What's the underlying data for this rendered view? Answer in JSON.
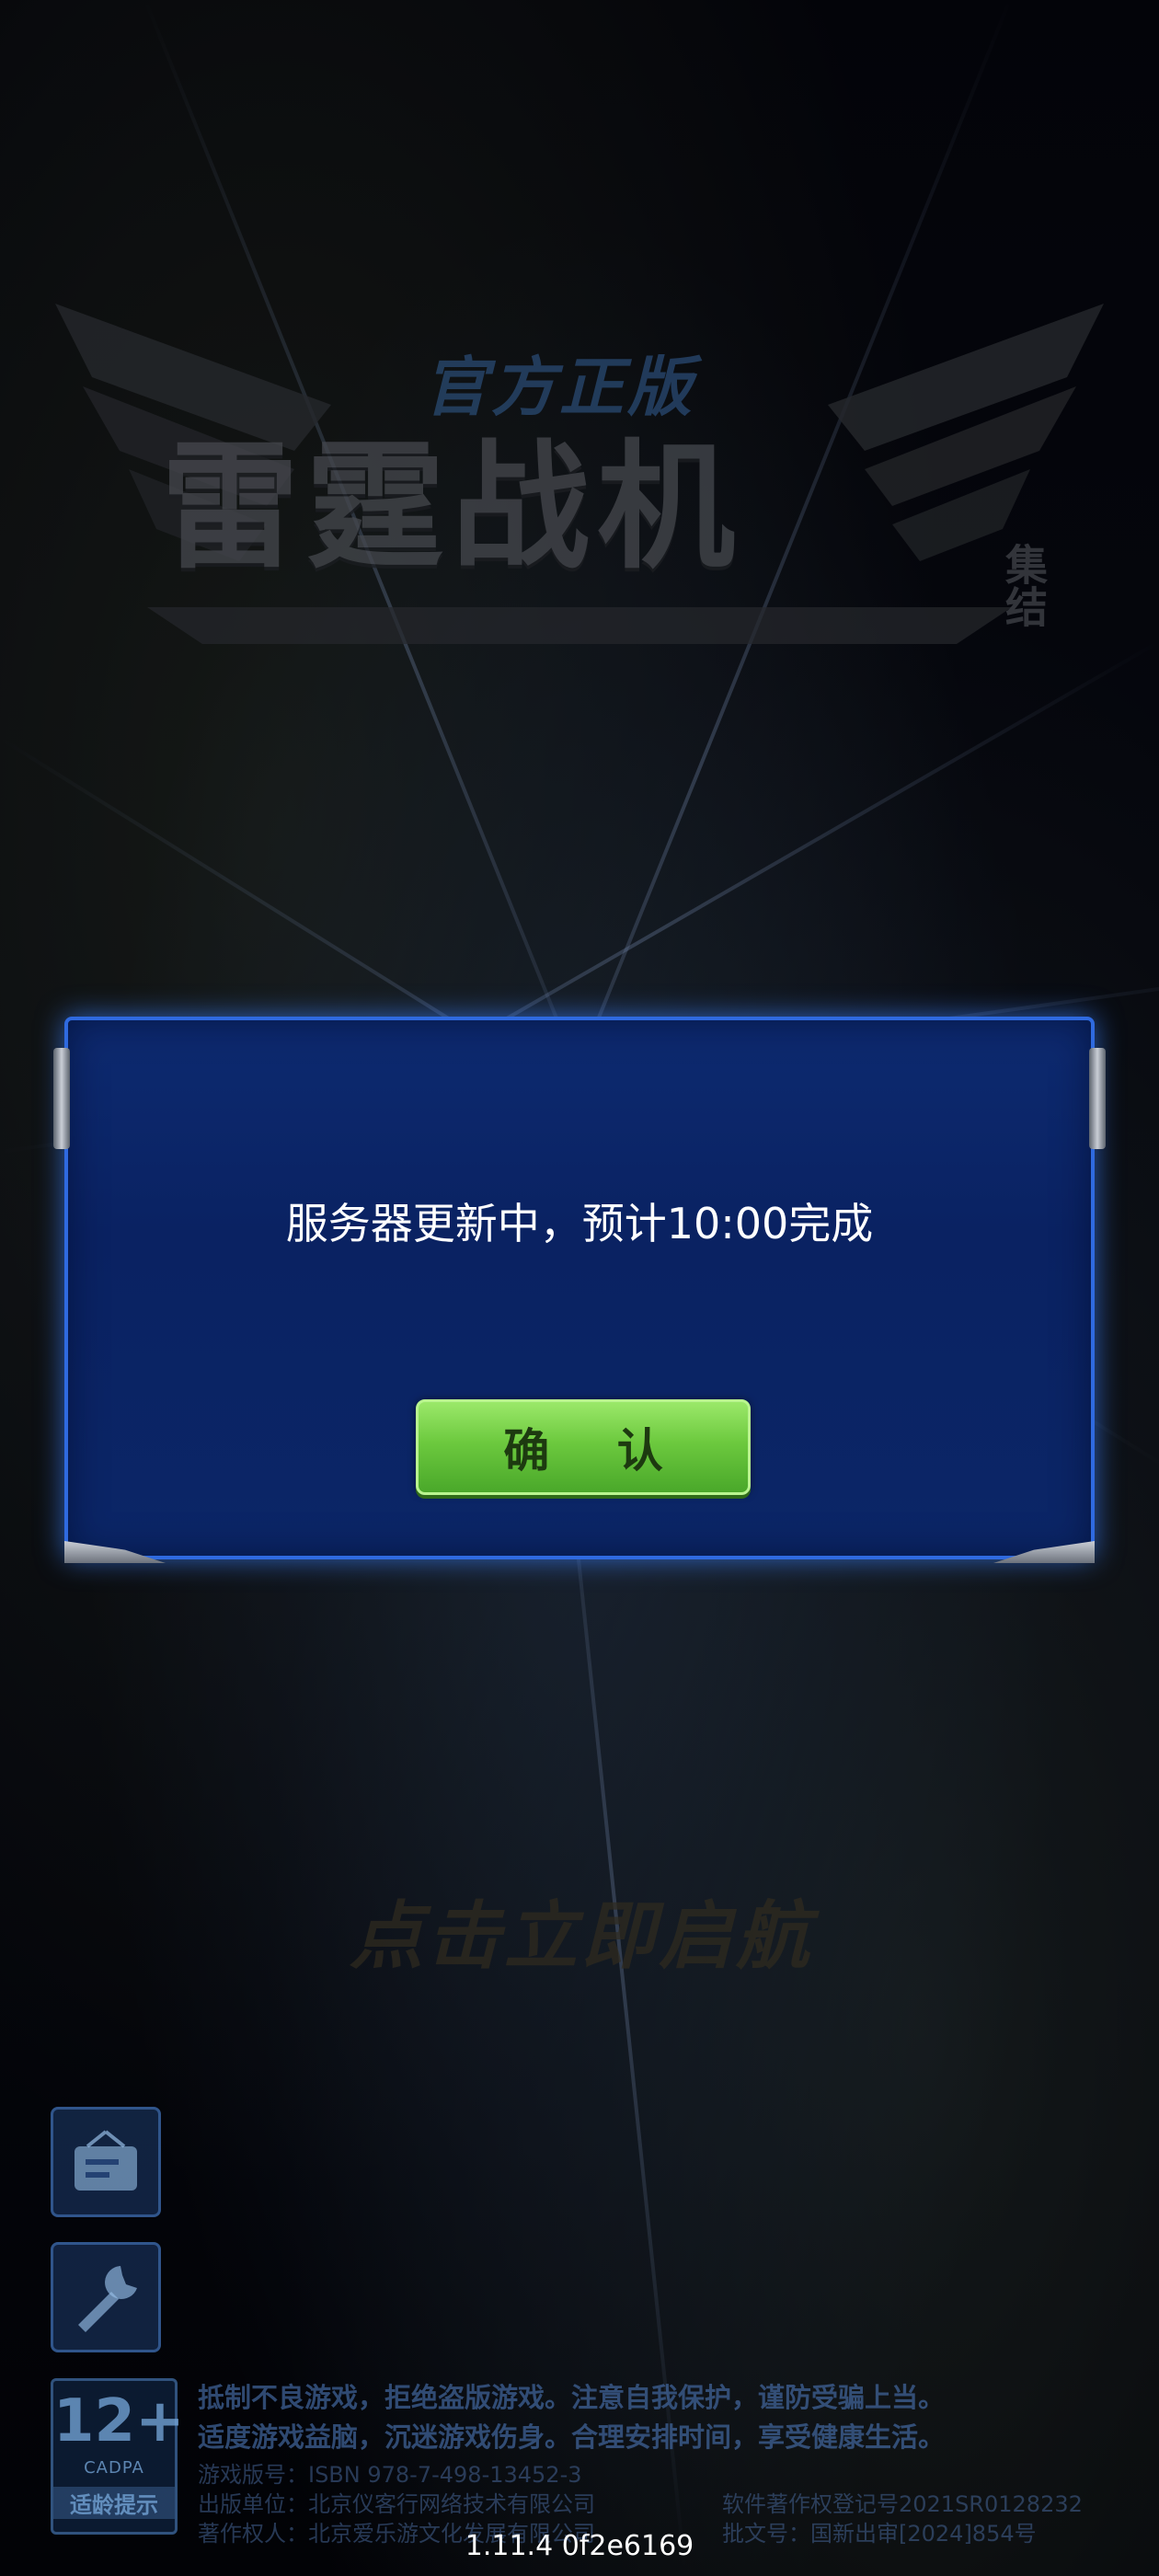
{
  "logo": {
    "subtitle": "官方正版",
    "title": "雷霆战机",
    "tag": "集结"
  },
  "start_prompt": "点击立即启航",
  "dialog": {
    "message": "服务器更新中，预计10:00完成",
    "confirm_label": "确 认"
  },
  "side_buttons": [
    {
      "icon": "notice-board-icon"
    },
    {
      "icon": "wrench-icon"
    }
  ],
  "age_rating": {
    "number": "12+",
    "org": "CADPA",
    "tip": "适龄提示"
  },
  "footer": {
    "notice_line1": "抵制不良游戏，拒绝盗版游戏。注意自我保护，谨防受骗上当。",
    "notice_line2": "适度游戏益脑，沉迷游戏伤身。合理安排时间，享受健康生活。",
    "isbn": "游戏版号：ISBN 978-7-498-13452-3",
    "publisher": "出版单位：北京仪客行网络技术有限公司",
    "copyright_owner": "著作权人：北京爱乐游文化发展有限公司",
    "software_reg": "软件著作权登记号2021SR0128232",
    "approval": "批文号：国新出审[2024]854号"
  },
  "version": "1.11.4 0f2e6169",
  "colors": {
    "dialog_bg": "#0b2667",
    "dialog_border": "#2f6ae0",
    "button_green": "#6cc93e"
  }
}
